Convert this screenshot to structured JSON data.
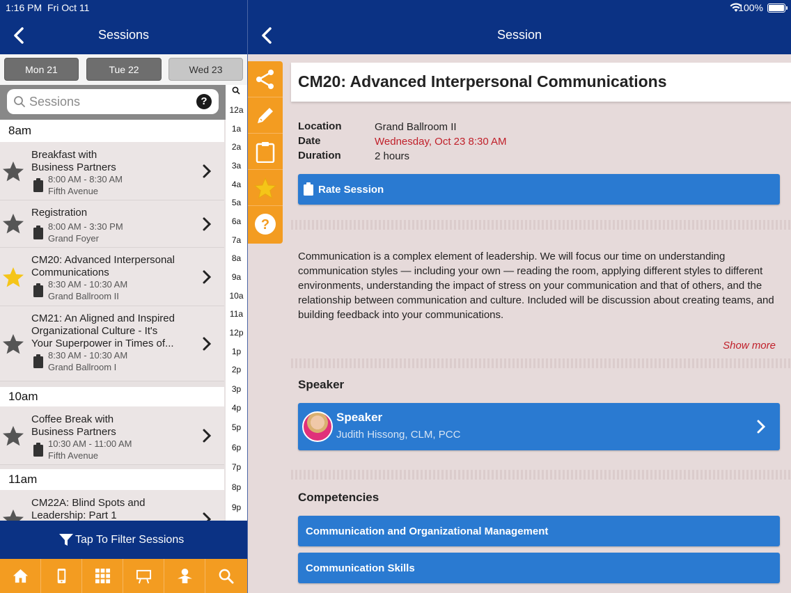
{
  "status_bar": {
    "time": "1:16 PM",
    "date": "Fri Oct 11",
    "battery": "100%"
  },
  "left_nav": {
    "title": "Sessions"
  },
  "right_nav": {
    "title": "Session"
  },
  "day_tabs": [
    {
      "label": "Mon 21",
      "active": false
    },
    {
      "label": "Tue 22",
      "active": false
    },
    {
      "label": "Wed 23",
      "active": true
    }
  ],
  "search": {
    "placeholder": "Sessions",
    "help": "?"
  },
  "index_bar": [
    "12a",
    "1a",
    "2a",
    "3a",
    "4a",
    "5a",
    "6a",
    "7a",
    "8a",
    "9a",
    "10a",
    "11a",
    "12p",
    "1p",
    "2p",
    "3p",
    "4p",
    "5p",
    "6p",
    "7p",
    "8p",
    "9p"
  ],
  "hour_headers": [
    "8am",
    "10am",
    "11am"
  ],
  "sessions": [
    {
      "title_lines": [
        "Breakfast with",
        "Business Partners"
      ],
      "time": "8:00 AM - 8:30 AM",
      "room": "Fifth Avenue",
      "favorite": false
    },
    {
      "title_lines": [
        "Registration"
      ],
      "time": "8:00 AM - 3:30 PM",
      "room": "Grand Foyer",
      "favorite": false
    },
    {
      "title_lines": [
        "CM20: Advanced Interpersonal",
        "Communications"
      ],
      "time": "8:30 AM - 10:30 AM",
      "room": "Grand Ballroom II",
      "favorite": true
    },
    {
      "title_lines": [
        "CM21: An Aligned and Inspired",
        "Organizational Culture - It's",
        "Your Superpower in Times of..."
      ],
      "time": "8:30 AM - 10:30 AM",
      "room": "Grand Ballroom I",
      "favorite": false
    },
    {
      "title_lines": [
        "Coffee Break with",
        "Business Partners"
      ],
      "time": "10:30 AM - 11:00 AM",
      "room": "Fifth Avenue",
      "favorite": false
    },
    {
      "title_lines": [
        "CM22A: Blind Spots and",
        "Leadership: Part 1"
      ],
      "time": "",
      "room": "",
      "favorite": false
    }
  ],
  "filter": {
    "label": "Tap To Filter Sessions"
  },
  "bottom_tabs": [
    "home-icon",
    "phone-icon",
    "grid-icon",
    "presentation-icon",
    "speaker-icon",
    "search-icon"
  ],
  "session_detail": {
    "title": "CM20: Advanced Interpersonal Communications",
    "location_label": "Location",
    "location": "Grand Ballroom II",
    "date_label": "Date",
    "date": "Wednesday, Oct 23 8:30 AM",
    "duration_label": "Duration",
    "duration": "2 hours",
    "rate_label": "Rate Session",
    "description": "Communication is a complex element of leadership. We will focus our time on understanding communication styles — including your own — reading the room, applying different styles to different environments, understanding the impact of stress on your communication and that of others, and the relationship between communication and culture. Included will be discussion about creating teams, and building feedback into your communications.",
    "show_more": "Show more",
    "speaker_section": "Speaker",
    "speaker_card_title": "Speaker",
    "speaker_name": "Judith Hissong, CLM, PCC",
    "competencies_section": "Competencies",
    "competencies": [
      "Communication and Organizational Management",
      "Communication Skills"
    ]
  },
  "action_rail": [
    "share-icon",
    "edit-icon",
    "notes-icon",
    "favorite-star-icon",
    "help-icon"
  ],
  "colors": {
    "nav_blue": "#0b3284",
    "accent_orange": "#f39c21",
    "button_blue": "#2a7ad1",
    "date_red": "#c0202a",
    "star_gold": "#f5c518"
  }
}
